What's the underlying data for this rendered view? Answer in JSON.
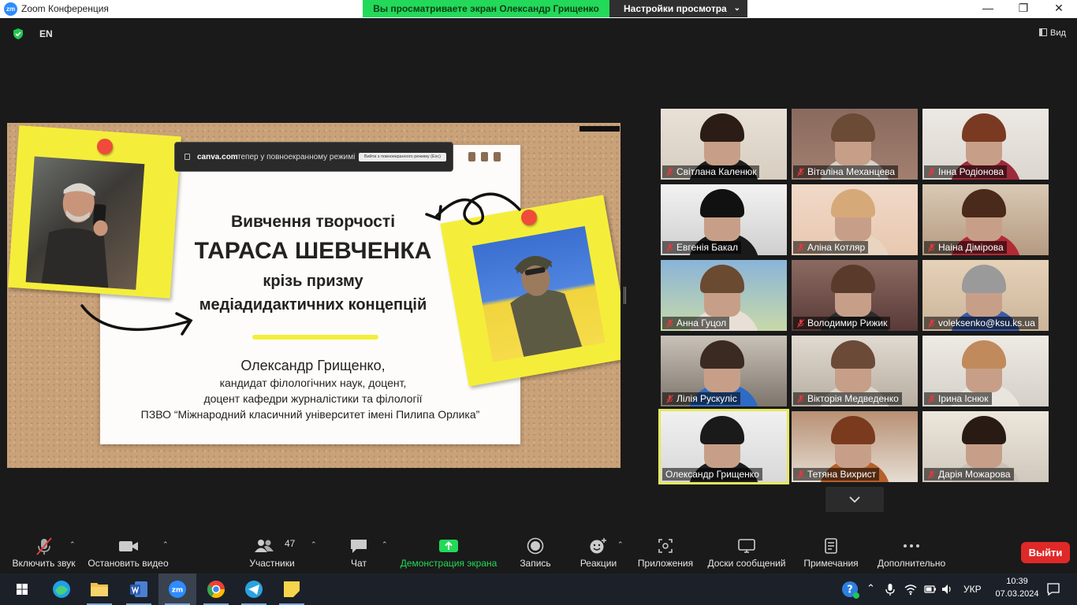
{
  "titlebar": {
    "app_logo": "zm",
    "title": "Zoom Конференция",
    "share_banner": "Вы просматриваете экран Олександр Грищенко",
    "view_settings": "Настройки просмотра",
    "minimize": "—",
    "maximize": "❐",
    "close": "✕"
  },
  "topbar": {
    "language": "EN",
    "view_label": "Вид"
  },
  "shared_screen": {
    "canva_domain": "canva.com",
    "canva_message": "тепер у повноекранному режимі",
    "canva_exit": "Вийти з повноекранного режиму (Esc)",
    "title_line1": "Вивчення творчості",
    "title_line2": "ТАРАСА ШЕВЧЕНКА",
    "title_line3": "крізь призму",
    "title_line4": "медіадидактичних концепцій",
    "author": "Олександр Грищенко,",
    "degree": "кандидат філологічних наук, доцент,",
    "position": "доцент кафедри журналістики та філології",
    "institution": "ПЗВО “Міжнародний класичний університет імені Пилипа Орлика”"
  },
  "participants": [
    {
      "name": "Світлана Каленюк",
      "muted": true
    },
    {
      "name": "Віталіна Механцева",
      "muted": true
    },
    {
      "name": "Інна Родіонова",
      "muted": true
    },
    {
      "name": "Евгенія Бакал",
      "muted": true
    },
    {
      "name": "Аліна Котляр",
      "muted": true
    },
    {
      "name": "Наіна Дімірова",
      "muted": true
    },
    {
      "name": "Анна Гуцол",
      "muted": true
    },
    {
      "name": "Володимир Рижик",
      "muted": true
    },
    {
      "name": "voleksenko@ksu.ks.ua",
      "muted": true
    },
    {
      "name": "Лілія Рускуліс",
      "muted": true
    },
    {
      "name": "Вікторія Медведенко",
      "muted": true
    },
    {
      "name": "Ірина Існюк",
      "muted": true
    },
    {
      "name": "Олександр Грищенко",
      "muted": false,
      "active_speaker": true
    },
    {
      "name": "Тетяна Вихрист",
      "muted": true
    },
    {
      "name": "Дарія Можарова",
      "muted": true
    }
  ],
  "toolbar": {
    "unmute": "Включить звук",
    "stop_video": "Остановить видео",
    "participants": "Участники",
    "participants_count": "47",
    "chat": "Чат",
    "share_screen": "Демонстрация экрана",
    "record": "Запись",
    "reactions": "Реакции",
    "apps": "Приложения",
    "whiteboards": "Доски сообщений",
    "notes": "Примечания",
    "more": "Дополнительно",
    "leave": "Выйти"
  },
  "taskbar": {
    "language": "УКР",
    "time": "10:39",
    "date": "07.03.2024",
    "apps": [
      "start-icon",
      "edge-icon",
      "file-explorer-icon",
      "word-icon",
      "zoom-icon",
      "chrome-icon",
      "telegram-icon",
      "sticky-notes-icon"
    ]
  },
  "colors": {
    "share_green": "#23d959",
    "leave_red": "#e02828",
    "active_speaker_border": "#e5e85d",
    "muted_red": "#e03b3b",
    "sticky_yellow": "#f4ee3a"
  }
}
